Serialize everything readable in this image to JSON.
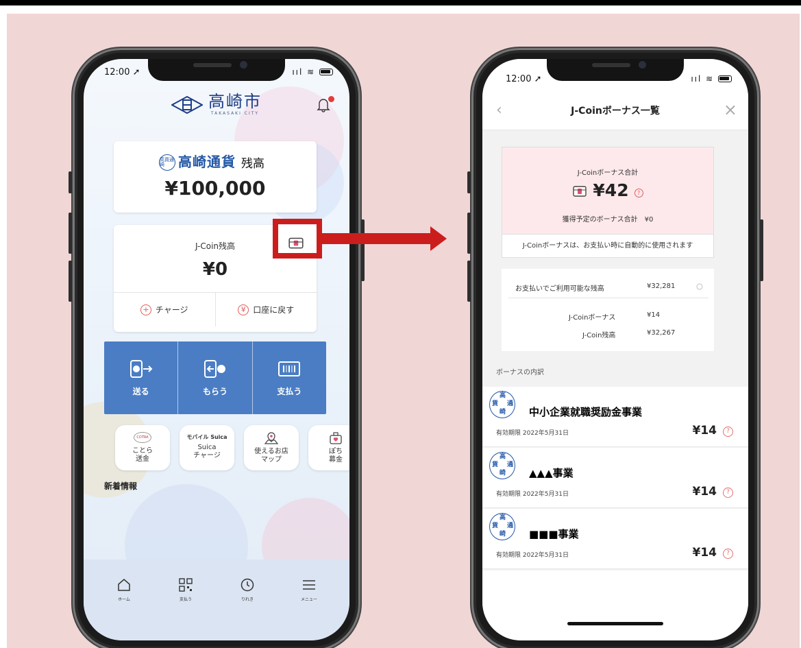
{
  "left_phone": {
    "status_time": "12:00",
    "city": {
      "name": "高崎市",
      "sub": "TAKASAKI CITY"
    },
    "currency": {
      "badge": "高貨通崎",
      "name": "高崎通貨",
      "suffix": "残高",
      "amount": "¥100,000"
    },
    "jcoin": {
      "label": "J-Coin残高",
      "amount": "¥0",
      "charge_label": "チャージ",
      "return_label": "口座に戻す"
    },
    "actions": [
      {
        "label": "送る",
        "icon": "send-icon"
      },
      {
        "label": "もらう",
        "icon": "receive-icon"
      },
      {
        "label": "支払う",
        "icon": "barcode-icon"
      }
    ],
    "quick": [
      {
        "label": "ことら\n送金",
        "logo": "COTRA",
        "icon": "cotra-logo"
      },
      {
        "label": "Suica\nチャージ",
        "logo": "モバイル Suica",
        "icon": "mobile-suica-logo"
      },
      {
        "label": "使えるお店\nマップ",
        "icon": "map-pin-icon"
      },
      {
        "label": "ぽち\n募金",
        "icon": "donation-icon"
      }
    ],
    "news_label": "新着情報",
    "tabs": [
      {
        "label": "ホーム",
        "icon": "home-icon"
      },
      {
        "label": "支払う",
        "icon": "qr-icon"
      },
      {
        "label": "りれき",
        "icon": "history-icon"
      },
      {
        "label": "メニュー",
        "icon": "menu-icon"
      }
    ]
  },
  "right_phone": {
    "status_time": "12:00",
    "title": "J-Coinボーナス一覧",
    "back_glyph": "‹",
    "close_glyph": "×",
    "summary": {
      "label": "J-Coinボーナス合計",
      "amount": "¥42",
      "pending": "獲得予定のボーナス合計　¥0"
    },
    "note": "J-Coinボーナスは、お支払い時に自動的に使用されます",
    "balance": {
      "available_label": "お支払いでご利用可能な残高",
      "available_value": "¥32,281",
      "bonus_label": "J-Coinボーナス",
      "bonus_value": "¥14",
      "jcoin_label": "J-Coin残高",
      "jcoin_value": "¥32,267"
    },
    "section_label": "ボーナスの内訳",
    "items": [
      {
        "title": "中小企業就職奨励金事業",
        "expiry": "有効期限 2022年5月31日",
        "amount": "¥14"
      },
      {
        "title": "▲▲▲事業",
        "expiry": "有効期限 2022年5月31日",
        "amount": "¥14"
      },
      {
        "title": "■■■事業",
        "expiry": "有効期限 2022年5月31日",
        "amount": "¥14"
      }
    ]
  },
  "colors": {
    "accent_blue": "#4a7dc4",
    "highlight_red": "#cc1d1d",
    "background_pink": "#f1d6d6"
  }
}
